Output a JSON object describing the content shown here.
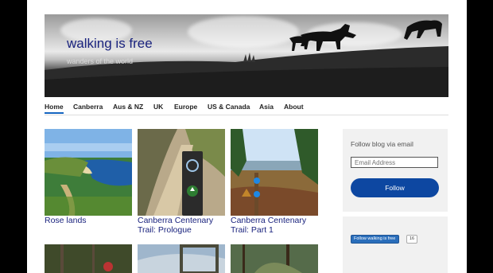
{
  "site": {
    "title": "walking is free",
    "description": "wanders of the world"
  },
  "nav": {
    "items": [
      {
        "label": "Home",
        "active": true
      },
      {
        "label": "Canberra"
      },
      {
        "label": "Aus & NZ"
      },
      {
        "label": "UK"
      },
      {
        "label": "Europe"
      },
      {
        "label": "US & Canada"
      },
      {
        "label": "Asia"
      },
      {
        "label": "About"
      }
    ]
  },
  "posts": [
    {
      "title_line1": "Rose lands",
      "title_line2": ""
    },
    {
      "title_line1": "Canberra Centenary",
      "title_line2": "Trail: Prologue"
    },
    {
      "title_line1": "Canberra Centenary",
      "title_line2": "Trail: Part 1"
    }
  ],
  "sidebar": {
    "follow_label": "Follow blog via email",
    "email_placeholder": "Email Address",
    "follow_button": "Follow",
    "wp_follow_label": "Follow walking is free",
    "wp_follow_count": "16"
  },
  "colors": {
    "accent": "#0d47a1",
    "title_link": "#1a237e",
    "page_bg": "#000000"
  }
}
